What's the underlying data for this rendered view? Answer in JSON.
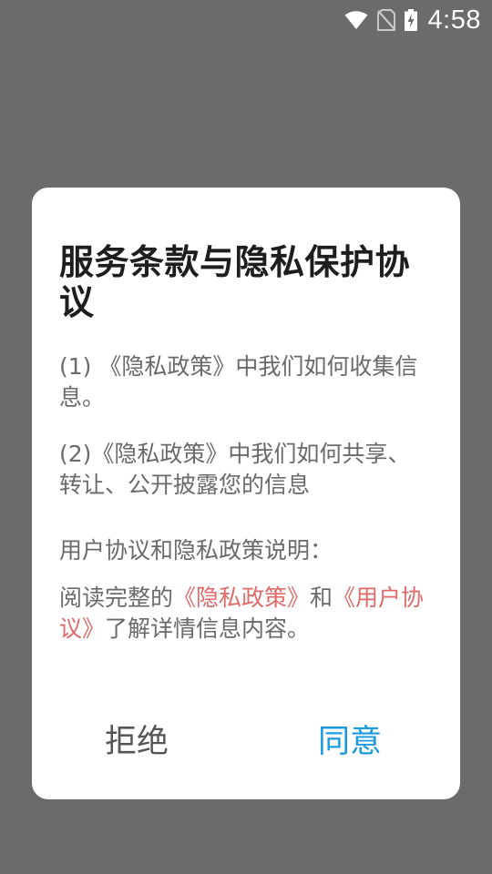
{
  "status_bar": {
    "time": "4:58",
    "icons": [
      "wifi-icon",
      "no-sim-icon",
      "battery-charging-icon"
    ]
  },
  "dialog": {
    "title": "服务条款与隐私保护协议",
    "paragraph1": "(1) 《隐私政策》中我们如何收集信息。",
    "paragraph2": "(2)《隐私政策》中我们如何共享、转让、公开披露您的信息",
    "paragraph3": "用户协议和隐私政策说明：",
    "paragraph4": {
      "prefix": "阅读完整的",
      "privacy_link": "《隐私政策》",
      "middle": "和",
      "user_link": "《用户协议》",
      "suffix": "了解详情信息内容。"
    },
    "reject_label": "拒绝",
    "agree_label": "同意"
  },
  "colors": {
    "background_dim": "#6b6b6b",
    "link": "#e06a6a",
    "agree": "#1a9ae0",
    "reject": "#555555"
  }
}
